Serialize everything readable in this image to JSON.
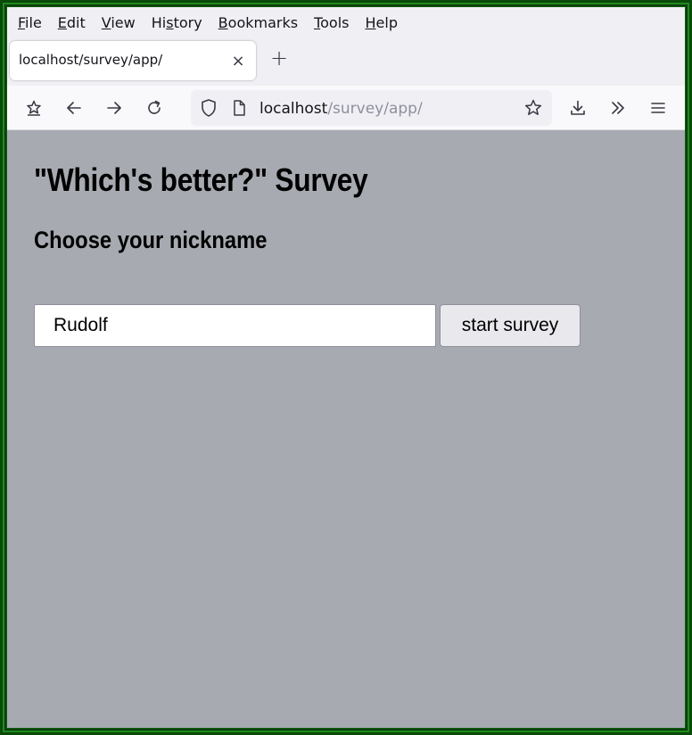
{
  "menu": {
    "items": [
      {
        "prefix": "",
        "key": "F",
        "suffix": "ile"
      },
      {
        "prefix": "",
        "key": "E",
        "suffix": "dit"
      },
      {
        "prefix": "",
        "key": "V",
        "suffix": "iew"
      },
      {
        "prefix": "Hi",
        "key": "s",
        "suffix": "tory"
      },
      {
        "prefix": "",
        "key": "B",
        "suffix": "ookmarks"
      },
      {
        "prefix": "",
        "key": "T",
        "suffix": "ools"
      },
      {
        "prefix": "",
        "key": "H",
        "suffix": "elp"
      }
    ]
  },
  "tab": {
    "title": "localhost/survey/app/",
    "close_glyph": "×"
  },
  "new_tab_glyph": "+",
  "url": {
    "host": "localhost",
    "path": "/survey/app/"
  },
  "icons": {
    "sidebar": "tab-sidebar-icon",
    "back": "back-arrow-icon",
    "forward": "forward-arrow-icon",
    "reload": "reload-icon",
    "shield": "tracking-shield-icon",
    "page": "page-icon",
    "bookmark": "star-icon",
    "downloads": "download-icon",
    "overflow": "chevrons-right-icon",
    "menu": "hamburger-menu-icon"
  },
  "page": {
    "title": "\"Which's better?\" Survey",
    "subtitle": "Choose your nickname",
    "nickname_value": "Rudolf",
    "start_button": "start survey"
  },
  "colors": {
    "content_background": "#a7aab1",
    "frame": "#0d5c0d",
    "toolbar": "#f9f9fb",
    "menubar": "#f0f0f4"
  }
}
